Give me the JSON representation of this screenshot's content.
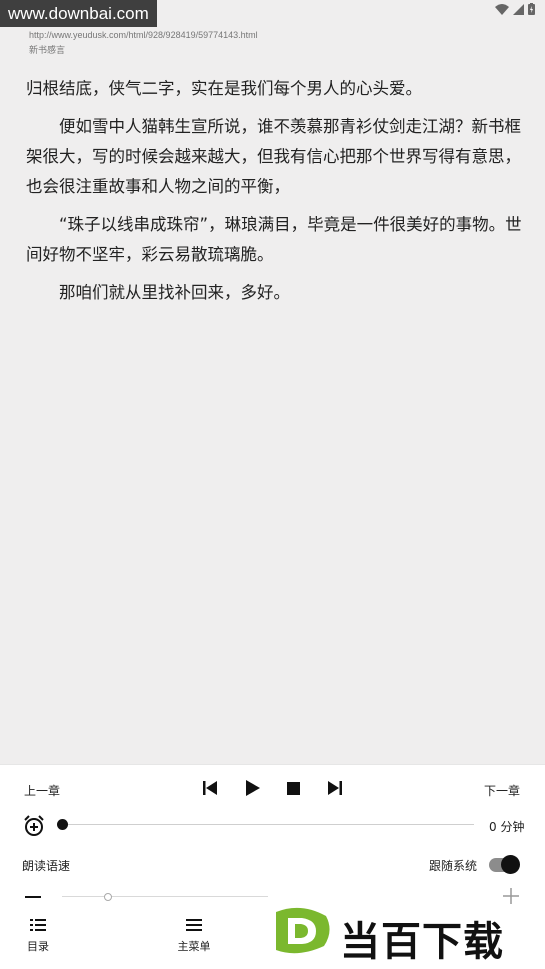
{
  "watermark_top": "www.downbai.com",
  "header": {
    "url": "http://www.yeudusk.com/html/928/928419/59774143.html",
    "chapter_title": "新书感言"
  },
  "content": {
    "paragraphs": [
      "归根结底，侠气二字，实在是我们每个男人的心头爱。",
      "便如雪中人猫韩生宣所说，谁不羡慕那青衫仗剑走江湖？新书框架很大，写的时候会越来越大，但我有信心把那个世界写得有意思，也会很注重故事和人物之间的平衡，",
      "“珠子以线串成珠帘”，琳琅满目，毕竟是一件很美好的事物。世间好物不坚牢，彩云易散琉璃脆。",
      "那咱们就从里找补回来，多好。"
    ]
  },
  "player": {
    "prev_chapter": "上一章",
    "next_chapter": "下一章",
    "timer_value": "0 分钟",
    "timer_progress": 0,
    "speed_label": "朗读语速",
    "follow_system_label": "跟随系统",
    "follow_system_on": true,
    "speed_level": 0.22
  },
  "bottom_nav": {
    "toc": "目录",
    "main_menu": "主菜单"
  },
  "brand_watermark": {
    "letter": "D",
    "text": "当百下载",
    "color": "#7bb82e"
  }
}
